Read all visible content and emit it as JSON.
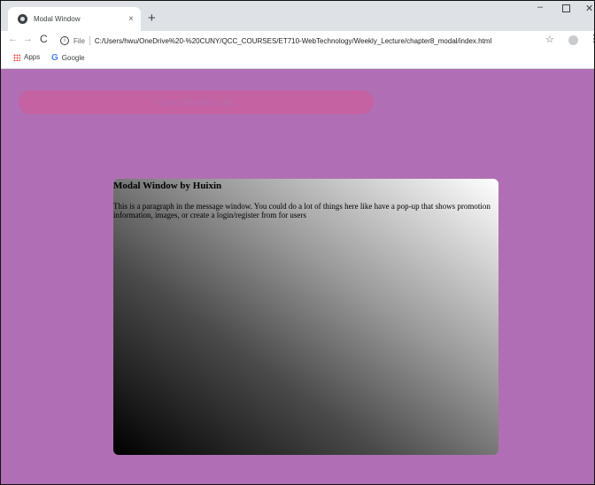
{
  "browser": {
    "tab_title": "Modal Window",
    "tab_close": "×",
    "new_tab": "+",
    "window_controls": {
      "minimize": "–",
      "close": "✕"
    },
    "nav": {
      "back": "←",
      "forward": "→",
      "reload": "C"
    },
    "address": {
      "scheme_label": "File",
      "url": "C:/Users/hwu/OneDrive%20-%20CUNY/QCC_COURSES/ET710-WebTechnology/Weekly_Lecture/chapter8_modal/index.html"
    },
    "star": "☆",
    "menu": "⋮",
    "bookmarks": [
      {
        "label": "Apps"
      },
      {
        "label": "Google",
        "icon_char": "G"
      }
    ]
  },
  "page": {
    "open_modal_link": "Open Modal Link",
    "modal": {
      "title": "Modal Window by Huixin",
      "body": "This is a paragraph in the message window. You could do a lot of things here like have a pop-up that shows promotion information, images, or create a login/register from for users"
    }
  },
  "colors": {
    "page_background": "#b06fb4",
    "link_button": "#c562a2",
    "modal_gradient_start": "#000000",
    "modal_gradient_end": "#ffffff"
  },
  "icons": [
    "globe-favicon",
    "close-icon",
    "plus-icon",
    "back-arrow-icon",
    "forward-arrow-icon",
    "reload-icon",
    "info-icon",
    "star-icon",
    "profile-icon",
    "menu-dots-icon",
    "apps-grid-icon",
    "google-icon"
  ]
}
